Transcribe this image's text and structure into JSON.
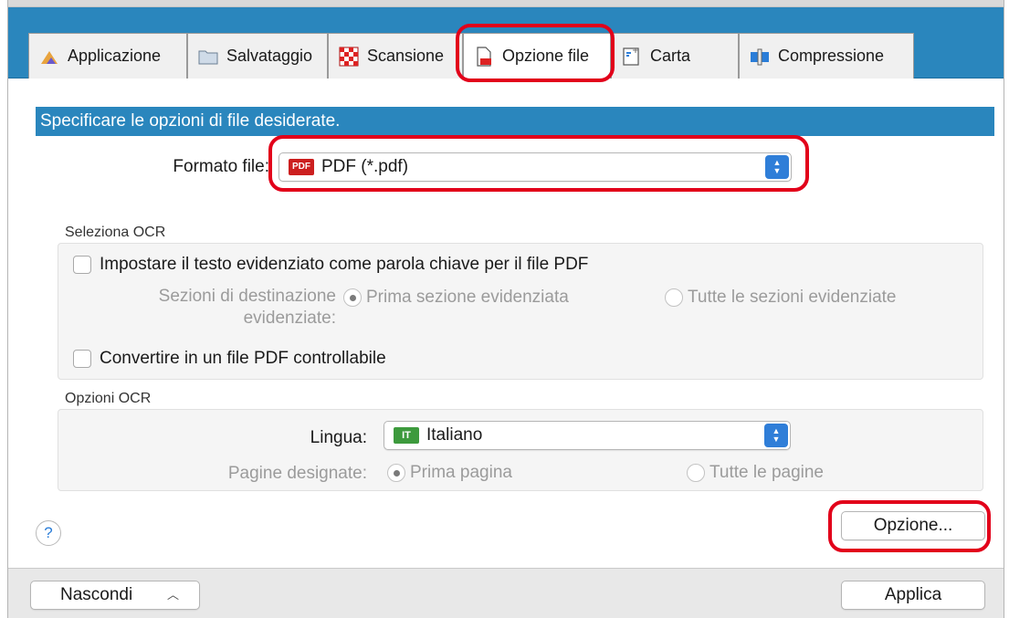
{
  "tabs": [
    {
      "label": "Applicazione",
      "icon": "application-icon"
    },
    {
      "label": "Salvataggio",
      "icon": "folder-icon"
    },
    {
      "label": "Scansione",
      "icon": "scan-icon"
    },
    {
      "label": "Opzione file",
      "icon": "file-option-icon",
      "active": true
    },
    {
      "label": "Carta",
      "icon": "paper-icon"
    },
    {
      "label": "Compressione",
      "icon": "compression-icon"
    }
  ],
  "header": {
    "title": "Specificare le opzioni di file desiderate."
  },
  "file_format": {
    "label": "Formato file:",
    "value": "PDF (*.pdf)",
    "badge": "PDF"
  },
  "ocr_select": {
    "section_title": "Seleziona OCR",
    "keyword_checkbox_label": "Impostare il testo evidenziato come parola chiave per il file PDF",
    "keyword_checked": false,
    "target_label_line1": "Sezioni di destinazione",
    "target_label_line2": "evidenziate:",
    "radio_first": "Prima sezione evidenziata",
    "radio_all": "Tutte le sezioni evidenziate",
    "searchable_checkbox_label": "Convertire in un file PDF controllabile",
    "searchable_checked": false
  },
  "ocr_options": {
    "section_title": "Opzioni OCR",
    "language_label": "Lingua:",
    "language_value": "Italiano",
    "language_badge": "IT",
    "pages_label": "Pagine designate:",
    "radio_first_page": "Prima pagina",
    "radio_all_pages": "Tutte le pagine"
  },
  "buttons": {
    "help": "?",
    "option": "Opzione...",
    "hide": "Nascondi",
    "apply": "Applica"
  },
  "colors": {
    "accent": "#2a86bd",
    "highlight_ring": "#e2001a",
    "pdf_badge": "#cc1f1f",
    "lang_badge": "#3d9a3d"
  }
}
